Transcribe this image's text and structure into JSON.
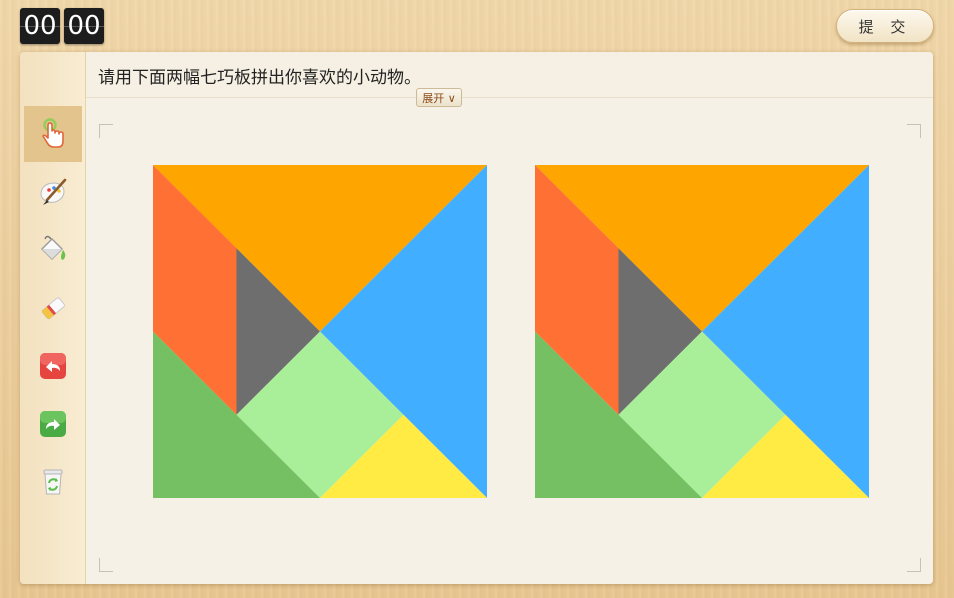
{
  "timer": {
    "minutes": "00",
    "seconds": "00"
  },
  "submit": {
    "label": "提 交"
  },
  "toolbar": {
    "tools": [
      {
        "name": "pointer-tool",
        "icon": "hand-pointer-icon",
        "active": true
      },
      {
        "name": "brush-tool",
        "icon": "paint-brush-icon",
        "active": false
      },
      {
        "name": "fill-tool",
        "icon": "paint-bucket-icon",
        "active": false
      },
      {
        "name": "eraser-tool",
        "icon": "eraser-icon",
        "active": false
      },
      {
        "name": "undo-tool",
        "icon": "undo-icon",
        "active": false
      },
      {
        "name": "redo-tool",
        "icon": "redo-icon",
        "active": false
      },
      {
        "name": "clear-tool",
        "icon": "recycle-bin-icon",
        "active": false
      }
    ]
  },
  "question": {
    "text": "请用下面两幅七巧板拼出你喜欢的小动物。",
    "expand_label": "展开 ∨"
  },
  "tangram_colors": {
    "orange": "#FFA500",
    "red_orange": "#FF7034",
    "gray": "#6E6E6E",
    "blue": "#42AEFF",
    "green": "#74C062",
    "light_green": "#A9EE98",
    "yellow": "#FFEB44"
  }
}
